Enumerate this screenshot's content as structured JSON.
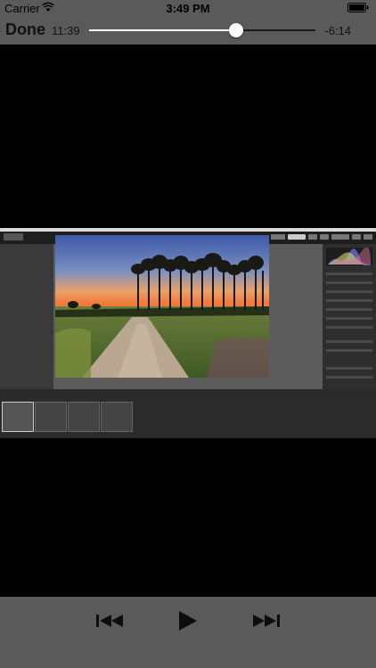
{
  "status_bar": {
    "carrier": "Carrier",
    "time": "3:49 PM"
  },
  "player": {
    "done_label": "Done",
    "elapsed": "11:39",
    "remaining": "-6:14",
    "progress": 0.65
  },
  "colors": {
    "bar_background": "#5a5a5a",
    "video_background": "#000000",
    "scrubber_played": "#ffffff",
    "scrubber_unplayed": "#1a1a1a"
  },
  "icons": {
    "wifi": "wifi-icon",
    "battery": "battery-icon",
    "previous": "skip-back-icon",
    "play": "play-icon",
    "next": "skip-forward-icon"
  }
}
